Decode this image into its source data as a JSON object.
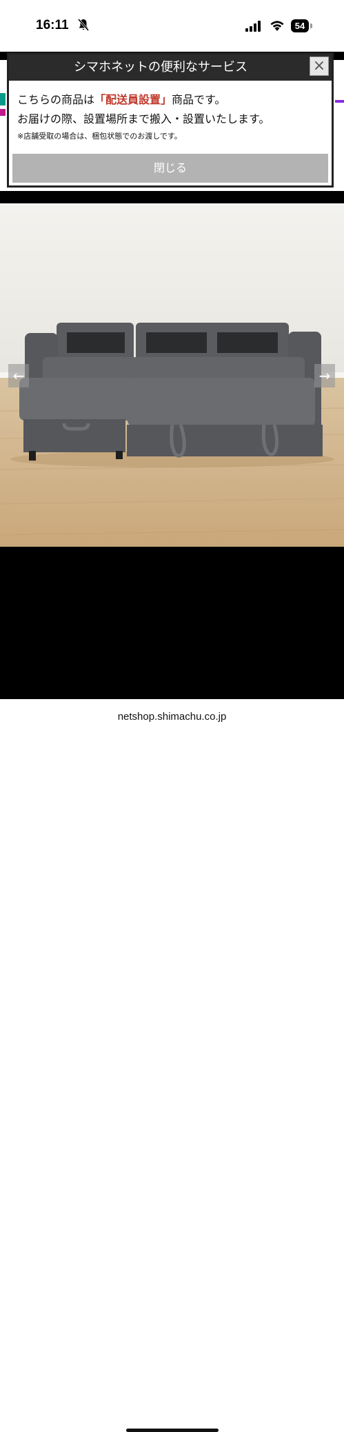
{
  "status_bar": {
    "time": "16:11",
    "battery": "54"
  },
  "modal": {
    "title": "シマホネットの便利なサービス",
    "close_label": "×",
    "line1_prefix": "こちらの商品は",
    "line1_highlight": "「配送員設置」",
    "line1_suffix": "商品です。",
    "line2": "お届けの際、設置場所まで搬入・設置いたします。",
    "note": "※店舗受取の場合は、梱包状態でのお渡しです。",
    "close_button": "閉じる",
    "highlight_color": "#c0392b"
  },
  "gallery": {
    "prev_arrow": "←",
    "next_arrow": "→",
    "image_subject": "sofa-bed-image"
  },
  "url_bar": {
    "url": "netshop.shimachu.co.jp"
  }
}
